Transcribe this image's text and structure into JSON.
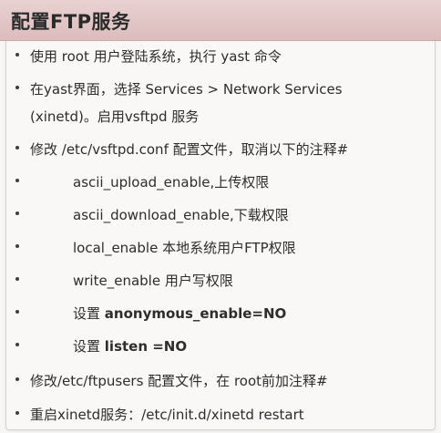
{
  "title": "配置FTP服务",
  "items": [
    {
      "type": "main",
      "parts": [
        {
          "t": "使用 root 用户登陆系统，执行 yast 命令",
          "b": false
        }
      ]
    },
    {
      "type": "main",
      "parts": [
        {
          "t": "在yast界面，选择 Services > Network Services",
          "b": false
        }
      ]
    },
    {
      "type": "cont",
      "parts": [
        {
          "t": "(xinetd)。启用vsftpd 服务",
          "b": false
        }
      ]
    },
    {
      "type": "main",
      "parts": [
        {
          "t": "修改 /etc/vsftpd.conf 配置文件，取消以下的注释#",
          "b": false
        }
      ]
    },
    {
      "type": "indent",
      "parts": [
        {
          "t": "ascii_upload_enable,上传权限",
          "b": false
        }
      ]
    },
    {
      "type": "indent",
      "parts": [
        {
          "t": "ascii_download_enable,下载权限",
          "b": false
        }
      ]
    },
    {
      "type": "indent",
      "parts": [
        {
          "t": "local_enable 本地系统用户FTP权限",
          "b": false
        }
      ]
    },
    {
      "type": "indent",
      "parts": [
        {
          "t": "write_enable 用户写权限",
          "b": false
        }
      ]
    },
    {
      "type": "indent",
      "parts": [
        {
          "t": "设置 ",
          "b": false
        },
        {
          "t": "anonymous_enable=NO",
          "b": true
        }
      ]
    },
    {
      "type": "indent",
      "parts": [
        {
          "t": "设置 ",
          "b": false
        },
        {
          "t": "listen =NO",
          "b": true
        }
      ]
    },
    {
      "type": "main",
      "parts": [
        {
          "t": "修改/etc/ftpusers 配置文件，在 root前加注释#",
          "b": false
        }
      ]
    },
    {
      "type": "main",
      "parts": [
        {
          "t": "重启xinetd服务：/etc/init.d/xinetd restart",
          "b": false
        }
      ]
    }
  ],
  "colors": {
    "title_band": "#dcbcbc",
    "text": "#2d2d2d",
    "background": "#f7f6f4"
  }
}
